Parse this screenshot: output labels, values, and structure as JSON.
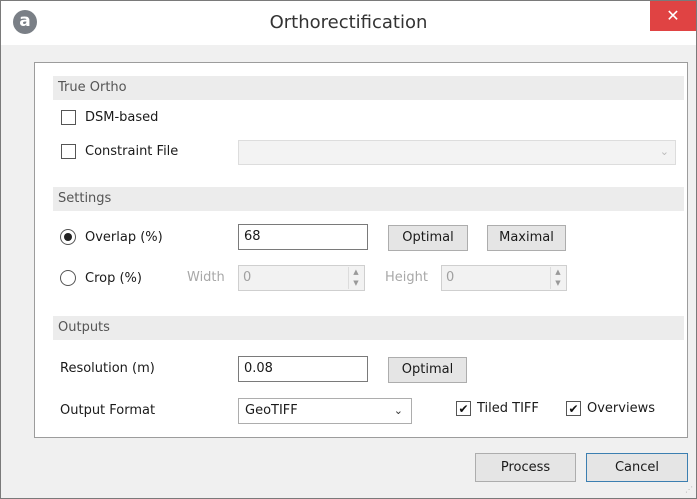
{
  "window": {
    "title": "Orthorectification",
    "close_symbol": "✕",
    "logo_glyph": "a"
  },
  "true_ortho": {
    "header": "True Ortho",
    "dsm_based": {
      "label": "DSM-based",
      "checked": false
    },
    "constraint_file": {
      "label": "Constraint File",
      "checked": false,
      "value": ""
    }
  },
  "settings": {
    "header": "Settings",
    "overlap": {
      "label": "Overlap (%)",
      "selected": true,
      "value": "68"
    },
    "optimal_label": "Optimal",
    "maximal_label": "Maximal",
    "crop": {
      "label": "Crop (%)",
      "selected": false,
      "width_label": "Width",
      "width_value": "0",
      "height_label": "Height",
      "height_value": "0"
    }
  },
  "outputs": {
    "header": "Outputs",
    "resolution": {
      "label": "Resolution  (m)",
      "value": "0.08"
    },
    "optimal_label": "Optimal",
    "output_format": {
      "label": "Output Format",
      "selected": "GeoTIFF"
    },
    "tiled_tiff": {
      "label": "Tiled TIFF",
      "checked": true
    },
    "overviews": {
      "label": "Overviews",
      "checked": true
    }
  },
  "footer": {
    "process_label": "Process",
    "cancel_label": "Cancel"
  },
  "colors": {
    "close_button": "#e04343",
    "focus_border": "#3c7fb1",
    "section_header_bg": "#ececec"
  }
}
